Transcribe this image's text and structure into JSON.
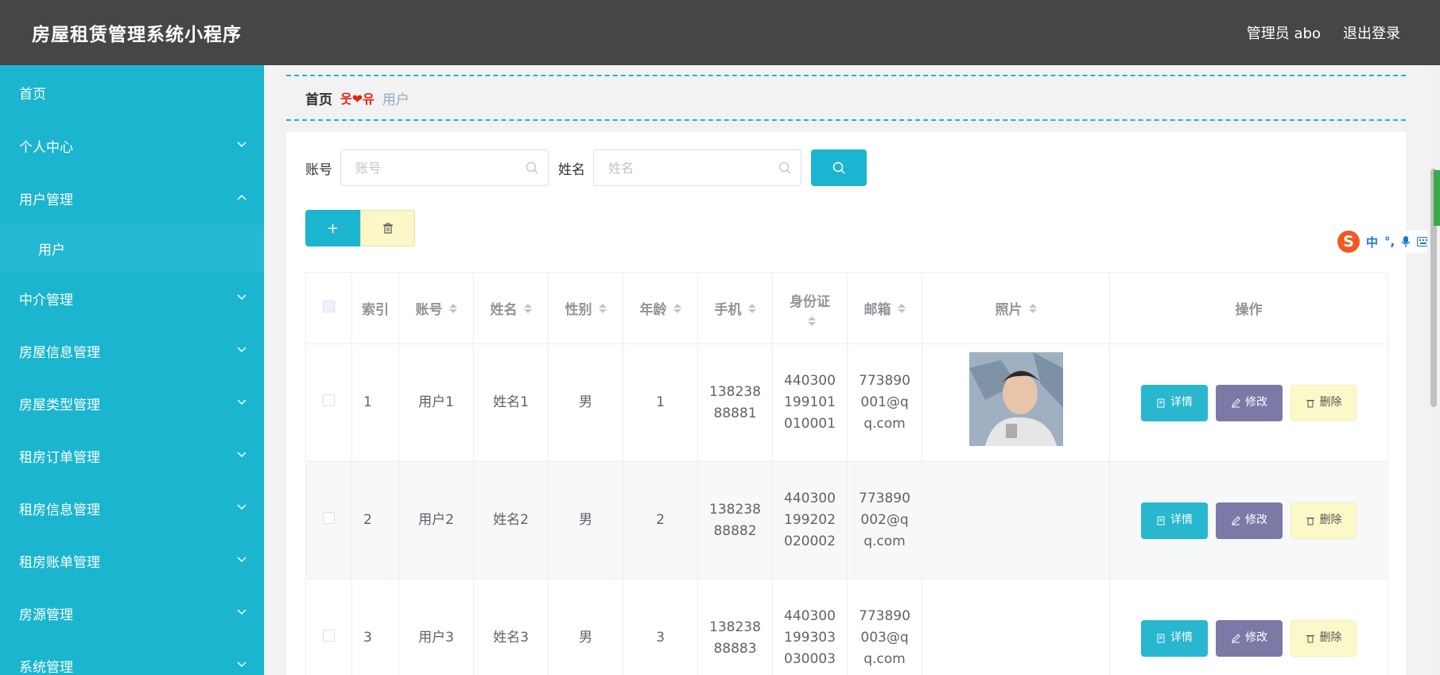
{
  "header": {
    "title": "房屋租赁管理系统小程序",
    "user_label": "管理员 abo",
    "logout_label": "退出登录"
  },
  "sidebar": {
    "items": [
      {
        "label": "首页",
        "expandable": false
      },
      {
        "label": "个人中心",
        "expandable": true,
        "expanded": false
      },
      {
        "label": "用户管理",
        "expandable": true,
        "expanded": true
      },
      {
        "label": "用户",
        "sub": true
      },
      {
        "label": "中介管理",
        "expandable": true,
        "expanded": false
      },
      {
        "label": "房屋信息管理",
        "expandable": true,
        "expanded": false
      },
      {
        "label": "房屋类型管理",
        "expandable": true,
        "expanded": false
      },
      {
        "label": "租房订单管理",
        "expandable": true,
        "expanded": false
      },
      {
        "label": "租房信息管理",
        "expandable": true,
        "expanded": false
      },
      {
        "label": "租房账单管理",
        "expandable": true,
        "expanded": false
      },
      {
        "label": "房源管理",
        "expandable": true,
        "expanded": false
      },
      {
        "label": "系统管理",
        "expandable": true,
        "expanded": false
      }
    ]
  },
  "breadcrumb": {
    "home": "首页",
    "separator": "웃❤유",
    "current": "用户"
  },
  "search": {
    "account_label": "账号",
    "account_placeholder": "账号",
    "account_value": "",
    "name_label": "姓名",
    "name_placeholder": "姓名",
    "name_value": ""
  },
  "actions": {
    "add_label": "+"
  },
  "table": {
    "headers": {
      "index": "索引",
      "account": "账号",
      "name": "姓名",
      "gender": "性别",
      "age": "年龄",
      "phone": "手机",
      "id_card": "身份证",
      "email": "邮箱",
      "photo": "照片",
      "ops": "操作"
    },
    "rows": [
      {
        "index": "1",
        "account": "用户1",
        "name": "姓名1",
        "gender": "男",
        "age": "1",
        "phone": "13823888881",
        "id_card": "440300199101010001",
        "email": "773890001@qq.com",
        "has_photo": true
      },
      {
        "index": "2",
        "account": "用户2",
        "name": "姓名2",
        "gender": "男",
        "age": "2",
        "phone": "13823888882",
        "id_card": "440300199202020002",
        "email": "773890002@qq.com",
        "has_photo": false
      },
      {
        "index": "3",
        "account": "用户3",
        "name": "姓名3",
        "gender": "男",
        "age": "3",
        "phone": "13823888883",
        "id_card": "440300199303030003",
        "email": "773890003@qq.com",
        "has_photo": false
      }
    ],
    "buttons": {
      "detail": "详情",
      "edit": "修改",
      "delete": "删除"
    }
  },
  "ime": {
    "logo": "S",
    "mode": "中"
  },
  "colors": {
    "accent": "#1bb5cf",
    "header_bg": "#464646",
    "edit_btn": "#7c79a7",
    "delete_btn": "#fcf9c9"
  }
}
